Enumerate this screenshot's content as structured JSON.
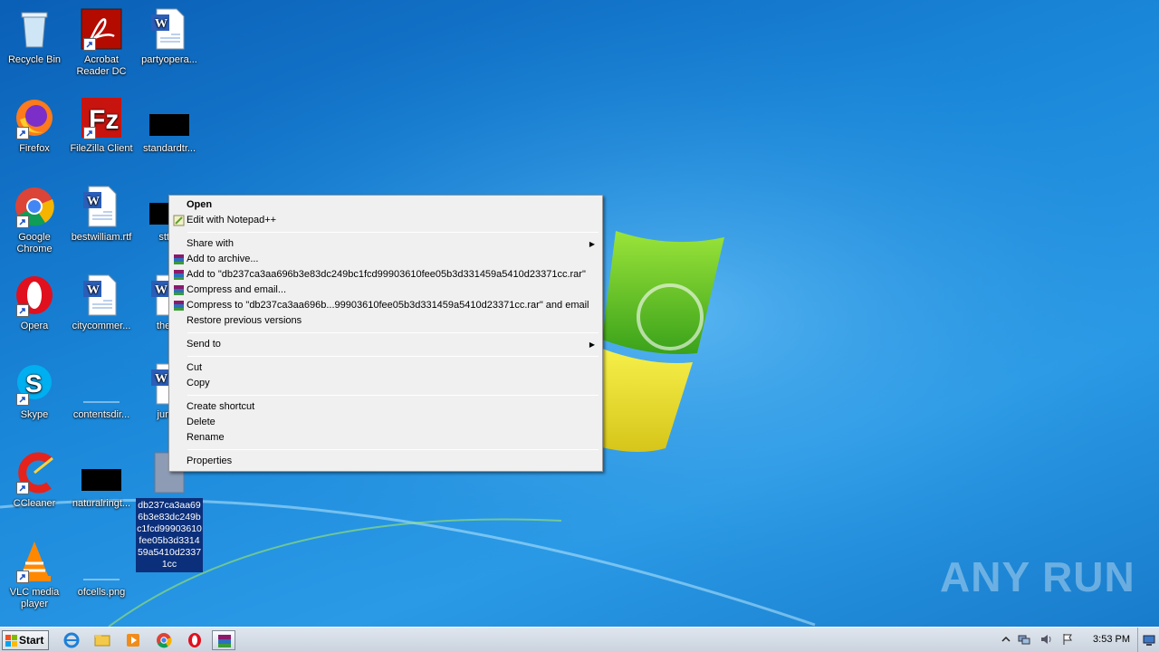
{
  "desktop": {
    "icons": [
      {
        "label": "Recycle Bin",
        "icon": "recycle-bin-icon"
      },
      {
        "label": "Acrobat Reader DC",
        "icon": "acrobat-icon"
      },
      {
        "label": "partyopera...",
        "icon": "word-doc-icon"
      },
      {
        "label": "Firefox",
        "icon": "firefox-icon"
      },
      {
        "label": "FileZilla Client",
        "icon": "filezilla-icon"
      },
      {
        "label": "standardtr...",
        "icon": "black-file-icon"
      },
      {
        "label": "Google Chrome",
        "icon": "chrome-icon"
      },
      {
        "label": "bestwilliam.rtf",
        "icon": "word-doc-icon"
      },
      {
        "label": "sttak",
        "icon": "black-file-icon"
      },
      {
        "label": "Opera",
        "icon": "opera-icon"
      },
      {
        "label": "citycommer...",
        "icon": "word-doc-icon"
      },
      {
        "label": "theref",
        "icon": "word-doc-icon"
      },
      {
        "label": "Skype",
        "icon": "skype-icon"
      },
      {
        "label": "contentsdir...",
        "icon": "blank-file-icon"
      },
      {
        "label": "junee",
        "icon": "word-doc-icon"
      },
      {
        "label": "CCleaner",
        "icon": "ccleaner-icon"
      },
      {
        "label": "naturalringt...",
        "icon": "black-file-icon"
      },
      {
        "label": "db237ca3aa696b3e83dc249bc1fcd99903610fee05b3d331459a5410d23371cc",
        "icon": "unknown-file-icon"
      },
      {
        "label": "VLC media player",
        "icon": "vlc-icon"
      },
      {
        "label": "ofcells.png",
        "icon": "blank-file-icon"
      }
    ]
  },
  "context_menu": {
    "open": "Open",
    "edit_notepad": "Edit with Notepad++",
    "share_with": "Share with",
    "add_archive": "Add to archive...",
    "add_to_rar": "Add to \"db237ca3aa696b3e83dc249bc1fcd99903610fee05b3d331459a5410d23371cc.rar\"",
    "compress_email": "Compress and email...",
    "compress_to_rar_email": "Compress to \"db237ca3aa696b...99903610fee05b3d331459a5410d23371cc.rar\" and email",
    "restore_versions": "Restore previous versions",
    "send_to": "Send to",
    "cut": "Cut",
    "copy": "Copy",
    "create_shortcut": "Create shortcut",
    "delete": "Delete",
    "rename": "Rename",
    "properties": "Properties"
  },
  "taskbar": {
    "start_label": "Start",
    "clock": "3:53 PM"
  },
  "watermark": "ANY RUN"
}
